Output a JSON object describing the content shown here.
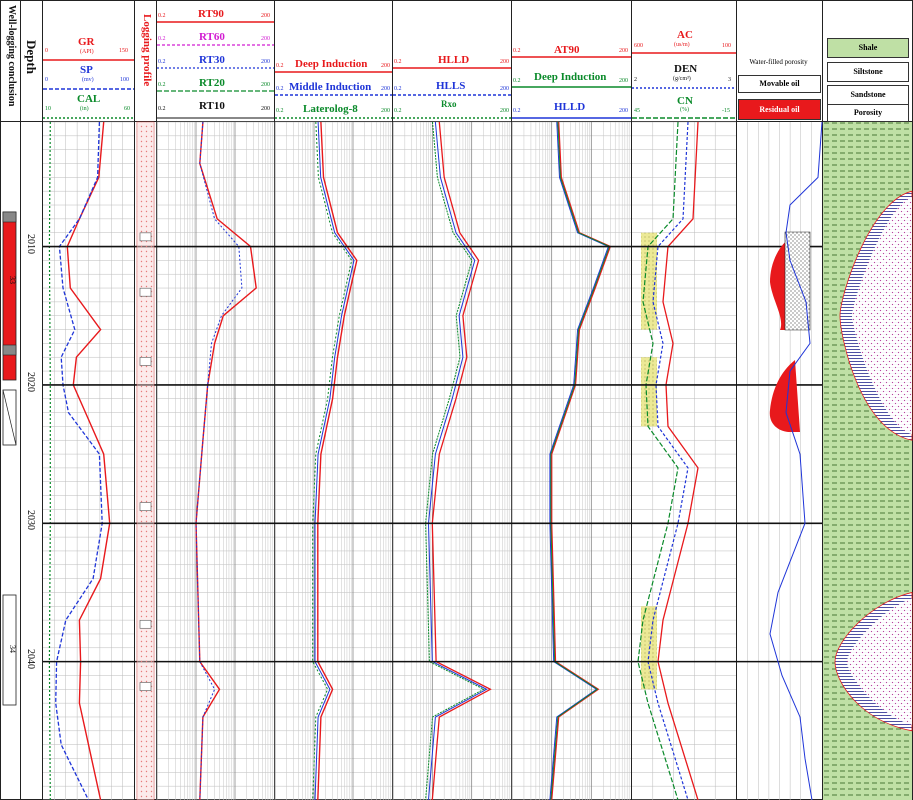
{
  "headers": {
    "conclusion": "Well-logging conclusion",
    "depth": "Depth",
    "profile": "Logging profile"
  },
  "track1": {
    "gr": {
      "name": "GR",
      "unit": "(API)",
      "min": "0",
      "max": "150"
    },
    "sp": {
      "name": "SP",
      "unit": "(mv)",
      "min": "0",
      "max": "100"
    },
    "cal": {
      "name": "CAL",
      "unit": "(in)",
      "min": "10",
      "max": "60"
    }
  },
  "track3": {
    "rt90": {
      "name": "RT90",
      "min": "0.2",
      "max": "200"
    },
    "rt60": {
      "name": "RT60",
      "min": "0.2",
      "max": "200"
    },
    "rt30": {
      "name": "RT30",
      "min": "0.2",
      "max": "200"
    },
    "rt20": {
      "name": "RT20",
      "min": "0.2",
      "max": "200"
    },
    "rt10": {
      "name": "RT10",
      "min": "0.2",
      "max": "200"
    }
  },
  "track4": {
    "deep": {
      "name": "Deep Induction",
      "min": "0.2",
      "max": "200"
    },
    "middle": {
      "name": "Middle Induction",
      "min": "0.2",
      "max": "200"
    },
    "ll8": {
      "name": "Laterolog-8",
      "min": "0.2",
      "max": "200"
    }
  },
  "track5": {
    "hlld": {
      "name": "HLLD",
      "min": "0.2",
      "max": "200"
    },
    "hlls": {
      "name": "HLLS",
      "min": "0.2",
      "max": "200"
    },
    "rxo": {
      "name": "Rxo",
      "min": "0.2",
      "max": "200"
    }
  },
  "track6": {
    "at90": {
      "name": "AT90",
      "min": "0.2",
      "max": "200"
    },
    "deep": {
      "name": "Deep Induction",
      "min": "0.2",
      "max": "200"
    },
    "hlld": {
      "name": "HLLD",
      "min": "0.2",
      "max": "200"
    }
  },
  "track7": {
    "ac": {
      "name": "AC",
      "unit": "(us/m)",
      "min": "600",
      "max": "100"
    },
    "den": {
      "name": "DEN",
      "unit": "(g/cm³)",
      "min": "2",
      "max": "3"
    },
    "cn": {
      "name": "CN",
      "unit": "(%)",
      "min": "45",
      "max": "-15"
    }
  },
  "track8": {
    "water": "Water-filled porosity",
    "movable": "Movable oil",
    "residual": "Residual oil"
  },
  "track9": {
    "shale": "Shale",
    "siltstone": "Siltstone",
    "sandstone": "Sandstone",
    "porosity": "Porosity"
  },
  "zones": {
    "z33": "33",
    "z34": "34"
  },
  "colors": {
    "red": "#e8191c",
    "blue": "#1f35d8",
    "green": "#0a8a2a",
    "magenta": "#d21cd2",
    "yellow": "#e8e07a",
    "navy": "#22238c"
  },
  "chart_data": {
    "type": "line",
    "ylabel": "Depth",
    "depth_ticks": [
      "2010",
      "2020",
      "2030",
      "2040"
    ],
    "depth_values": [
      2010,
      2020,
      2030,
      2040
    ],
    "ylim": [
      2001,
      2050
    ],
    "series": [
      {
        "name": "GR",
        "x_range": [
          0,
          150
        ],
        "depth": [
          2001,
          2005,
          2008,
          2010,
          2013,
          2016,
          2018,
          2020,
          2022,
          2025,
          2030,
          2034,
          2037,
          2040,
          2043,
          2046,
          2050
        ],
        "values": [
          100,
          92,
          60,
          40,
          45,
          95,
          55,
          50,
          70,
          100,
          110,
          95,
          60,
          62,
          60,
          75,
          95
        ]
      },
      {
        "name": "SP",
        "x_range": [
          0,
          100
        ],
        "depth": [
          2001,
          2005,
          2008,
          2010,
          2013,
          2016,
          2018,
          2020,
          2022,
          2025,
          2030,
          2034,
          2037,
          2040,
          2043,
          2046,
          2050
        ],
        "values": [
          62,
          60,
          40,
          18,
          22,
          35,
          20,
          22,
          28,
          62,
          65,
          55,
          25,
          15,
          14,
          20,
          50
        ]
      },
      {
        "name": "CAL",
        "x_range": [
          10,
          60
        ],
        "depth": [
          2001,
          2010,
          2020,
          2030,
          2040,
          2050
        ],
        "values": [
          14,
          13.5,
          14,
          14,
          13.5,
          14
        ]
      },
      {
        "name": "RT90",
        "x_range": [
          0.2,
          200
        ],
        "depth": [
          2001,
          2004,
          2008,
          2010,
          2013,
          2015,
          2017,
          2020,
          2024,
          2030,
          2040,
          2042,
          2044,
          2050
        ],
        "values": [
          3,
          2.5,
          7,
          50,
          70,
          10,
          6,
          4,
          3,
          2,
          2.5,
          8,
          3,
          2.5
        ]
      },
      {
        "name": "RT30",
        "x_range": [
          0.2,
          200
        ],
        "depth": [
          2001,
          2004,
          2008,
          2010,
          2013,
          2015,
          2017,
          2020,
          2024,
          2030,
          2040,
          2042,
          2044,
          2050
        ],
        "values": [
          3,
          2.5,
          6,
          25,
          30,
          9,
          5,
          4,
          3,
          2,
          2.5,
          6,
          3,
          2.5
        ]
      },
      {
        "name": "Deep Induction",
        "x_range": [
          0.2,
          200
        ],
        "depth": [
          2001,
          2005,
          2009,
          2011,
          2015,
          2018,
          2021,
          2025,
          2030,
          2040,
          2042,
          2044,
          2050
        ],
        "values": [
          3,
          3.5,
          8,
          25,
          12,
          8,
          6,
          3,
          2.5,
          2.5,
          6,
          3,
          2.5
        ]
      },
      {
        "name": "HLLD",
        "x_range": [
          0.2,
          200
        ],
        "depth": [
          2001,
          2005,
          2009,
          2011,
          2015,
          2018,
          2021,
          2025,
          2030,
          2040,
          2042,
          2044,
          2050
        ],
        "values": [
          3,
          4,
          10,
          30,
          12,
          15,
          8,
          3,
          2,
          2.5,
          60,
          3,
          2
        ]
      },
      {
        "name": "AT90",
        "x_range": [
          0.2,
          200
        ],
        "depth": [
          2001,
          2005,
          2009,
          2010,
          2013,
          2016,
          2020,
          2025,
          2030,
          2040,
          2042,
          2044,
          2050
        ],
        "values": [
          3,
          3.5,
          10,
          60,
          25,
          10,
          8,
          2,
          2,
          2.5,
          30,
          3,
          2
        ]
      }
    ]
  }
}
